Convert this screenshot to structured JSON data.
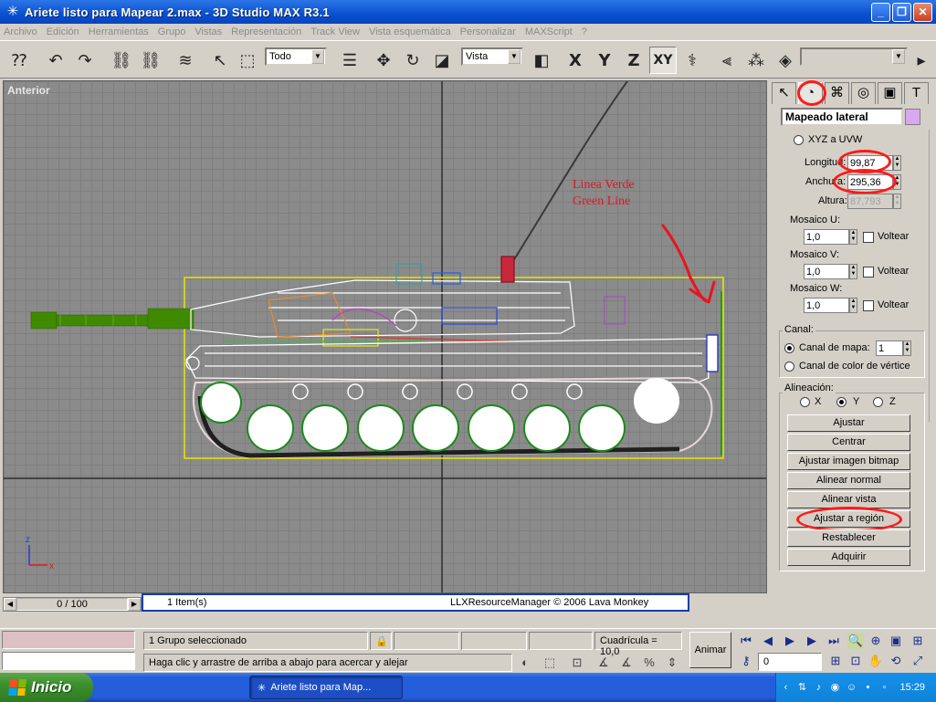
{
  "window": {
    "title": "Ariete listo para Mapear 2.max - 3D Studio MAX R3.1",
    "icon": "max-asterisk-icon",
    "controls": [
      "minimize",
      "maximize",
      "close"
    ]
  },
  "menu": [
    "Archivo",
    "Edición",
    "Herramientas",
    "Grupo",
    "Vistas",
    "Representación",
    "Track View",
    "Vista esquemática",
    "Personalizar",
    "MAXScript",
    "?"
  ],
  "toolbar": {
    "selection_filter": "Todo",
    "coord_system": "Vista",
    "axis_x": "X",
    "axis_y": "Y",
    "axis_z": "Z",
    "axis_xy": "XY"
  },
  "viewport": {
    "label": "Anterior",
    "annotation_line1": "Linea Verde",
    "annotation_line2": "Green Line",
    "axis_z": "z",
    "axis_x": "x",
    "colors": {
      "background": "#8b8b8b",
      "annotation": "#e8141e",
      "gizmo": "#e8e800",
      "model": "#ffffff",
      "barrel": "#3f8a00"
    }
  },
  "command_panel": {
    "modifier_name": "Mapeado lateral",
    "modifier_color": "#d8a8f0",
    "xyz_to_uvw": "XYZ a UVW",
    "length_label": "Longitud:",
    "length_value": "99,87",
    "width_label": "Anchura:",
    "width_value": "295,36",
    "height_label": "Altura:",
    "height_value": "87,793",
    "tile_u_label": "Mosaico U:",
    "tile_u_value": "1,0",
    "tile_v_label": "Mosaico V:",
    "tile_v_value": "1,0",
    "tile_w_label": "Mosaico W:",
    "tile_w_value": "1,0",
    "flip_label": "Voltear",
    "channel_group": "Canal:",
    "map_channel_label": "Canal de mapa:",
    "map_channel_value": "1",
    "vertex_color_label": "Canal de color de vértice",
    "alignment_group": "Alineación:",
    "align_x": "X",
    "align_y": "Y",
    "align_z": "Z",
    "buttons": [
      "Ajustar",
      "Centrar",
      "Ajustar imagen bitmap",
      "Alinear normal",
      "Alinear vista",
      "Ajustar a región",
      "Restablecer",
      "Adquirir"
    ]
  },
  "timeline": {
    "frame": "0 / 100"
  },
  "scriptbar": {
    "items": "1 Item(s)",
    "resource": "LLXResourceManager © 2006 Lava Monkey"
  },
  "status": {
    "selection": "1 Grupo seleccionado",
    "prompt": "Haga clic y arrastre de arriba a abajo para acercar y alejar",
    "grid": "Cuadrícula = 10,0",
    "animate": "Animar",
    "frame_field": "0"
  },
  "taskbar": {
    "start": "Inicio",
    "task": "Ariete listo para Map...",
    "clock": "15:29"
  }
}
